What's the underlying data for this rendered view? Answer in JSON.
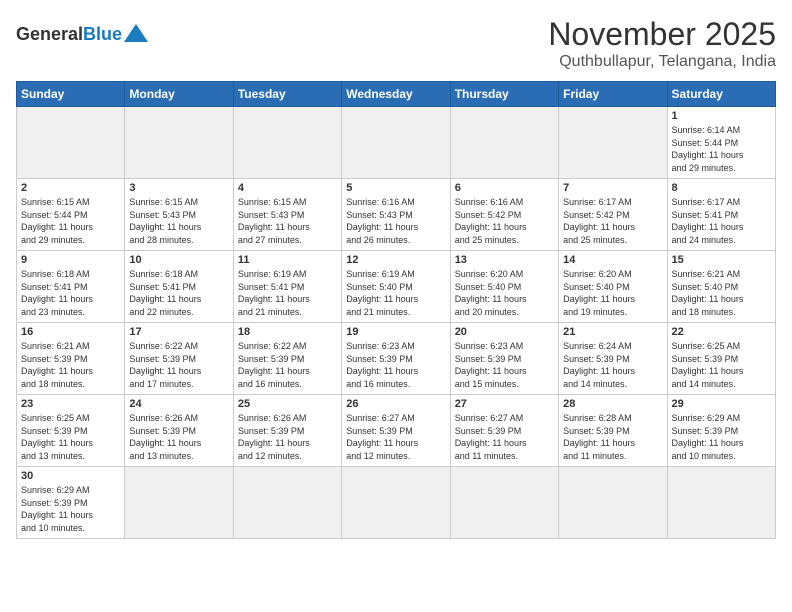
{
  "header": {
    "logo_general": "General",
    "logo_blue": "Blue",
    "title": "November 2025",
    "location": "Quthbullapur, Telangana, India"
  },
  "weekdays": [
    "Sunday",
    "Monday",
    "Tuesday",
    "Wednesday",
    "Thursday",
    "Friday",
    "Saturday"
  ],
  "weeks": [
    [
      {
        "day": "",
        "info": ""
      },
      {
        "day": "",
        "info": ""
      },
      {
        "day": "",
        "info": ""
      },
      {
        "day": "",
        "info": ""
      },
      {
        "day": "",
        "info": ""
      },
      {
        "day": "",
        "info": ""
      },
      {
        "day": "1",
        "info": "Sunrise: 6:14 AM\nSunset: 5:44 PM\nDaylight: 11 hours\nand 29 minutes."
      }
    ],
    [
      {
        "day": "2",
        "info": "Sunrise: 6:15 AM\nSunset: 5:44 PM\nDaylight: 11 hours\nand 29 minutes."
      },
      {
        "day": "3",
        "info": "Sunrise: 6:15 AM\nSunset: 5:43 PM\nDaylight: 11 hours\nand 28 minutes."
      },
      {
        "day": "4",
        "info": "Sunrise: 6:15 AM\nSunset: 5:43 PM\nDaylight: 11 hours\nand 27 minutes."
      },
      {
        "day": "5",
        "info": "Sunrise: 6:16 AM\nSunset: 5:43 PM\nDaylight: 11 hours\nand 26 minutes."
      },
      {
        "day": "6",
        "info": "Sunrise: 6:16 AM\nSunset: 5:42 PM\nDaylight: 11 hours\nand 25 minutes."
      },
      {
        "day": "7",
        "info": "Sunrise: 6:17 AM\nSunset: 5:42 PM\nDaylight: 11 hours\nand 25 minutes."
      },
      {
        "day": "8",
        "info": "Sunrise: 6:17 AM\nSunset: 5:41 PM\nDaylight: 11 hours\nand 24 minutes."
      }
    ],
    [
      {
        "day": "9",
        "info": "Sunrise: 6:18 AM\nSunset: 5:41 PM\nDaylight: 11 hours\nand 23 minutes."
      },
      {
        "day": "10",
        "info": "Sunrise: 6:18 AM\nSunset: 5:41 PM\nDaylight: 11 hours\nand 22 minutes."
      },
      {
        "day": "11",
        "info": "Sunrise: 6:19 AM\nSunset: 5:41 PM\nDaylight: 11 hours\nand 21 minutes."
      },
      {
        "day": "12",
        "info": "Sunrise: 6:19 AM\nSunset: 5:40 PM\nDaylight: 11 hours\nand 21 minutes."
      },
      {
        "day": "13",
        "info": "Sunrise: 6:20 AM\nSunset: 5:40 PM\nDaylight: 11 hours\nand 20 minutes."
      },
      {
        "day": "14",
        "info": "Sunrise: 6:20 AM\nSunset: 5:40 PM\nDaylight: 11 hours\nand 19 minutes."
      },
      {
        "day": "15",
        "info": "Sunrise: 6:21 AM\nSunset: 5:40 PM\nDaylight: 11 hours\nand 18 minutes."
      }
    ],
    [
      {
        "day": "16",
        "info": "Sunrise: 6:21 AM\nSunset: 5:39 PM\nDaylight: 11 hours\nand 18 minutes."
      },
      {
        "day": "17",
        "info": "Sunrise: 6:22 AM\nSunset: 5:39 PM\nDaylight: 11 hours\nand 17 minutes."
      },
      {
        "day": "18",
        "info": "Sunrise: 6:22 AM\nSunset: 5:39 PM\nDaylight: 11 hours\nand 16 minutes."
      },
      {
        "day": "19",
        "info": "Sunrise: 6:23 AM\nSunset: 5:39 PM\nDaylight: 11 hours\nand 16 minutes."
      },
      {
        "day": "20",
        "info": "Sunrise: 6:23 AM\nSunset: 5:39 PM\nDaylight: 11 hours\nand 15 minutes."
      },
      {
        "day": "21",
        "info": "Sunrise: 6:24 AM\nSunset: 5:39 PM\nDaylight: 11 hours\nand 14 minutes."
      },
      {
        "day": "22",
        "info": "Sunrise: 6:25 AM\nSunset: 5:39 PM\nDaylight: 11 hours\nand 14 minutes."
      }
    ],
    [
      {
        "day": "23",
        "info": "Sunrise: 6:25 AM\nSunset: 5:39 PM\nDaylight: 11 hours\nand 13 minutes."
      },
      {
        "day": "24",
        "info": "Sunrise: 6:26 AM\nSunset: 5:39 PM\nDaylight: 11 hours\nand 13 minutes."
      },
      {
        "day": "25",
        "info": "Sunrise: 6:26 AM\nSunset: 5:39 PM\nDaylight: 11 hours\nand 12 minutes."
      },
      {
        "day": "26",
        "info": "Sunrise: 6:27 AM\nSunset: 5:39 PM\nDaylight: 11 hours\nand 12 minutes."
      },
      {
        "day": "27",
        "info": "Sunrise: 6:27 AM\nSunset: 5:39 PM\nDaylight: 11 hours\nand 11 minutes."
      },
      {
        "day": "28",
        "info": "Sunrise: 6:28 AM\nSunset: 5:39 PM\nDaylight: 11 hours\nand 11 minutes."
      },
      {
        "day": "29",
        "info": "Sunrise: 6:29 AM\nSunset: 5:39 PM\nDaylight: 11 hours\nand 10 minutes."
      }
    ],
    [
      {
        "day": "30",
        "info": "Sunrise: 6:29 AM\nSunset: 5:39 PM\nDaylight: 11 hours\nand 10 minutes."
      },
      {
        "day": "",
        "info": ""
      },
      {
        "day": "",
        "info": ""
      },
      {
        "day": "",
        "info": ""
      },
      {
        "day": "",
        "info": ""
      },
      {
        "day": "",
        "info": ""
      },
      {
        "day": "",
        "info": ""
      }
    ]
  ]
}
